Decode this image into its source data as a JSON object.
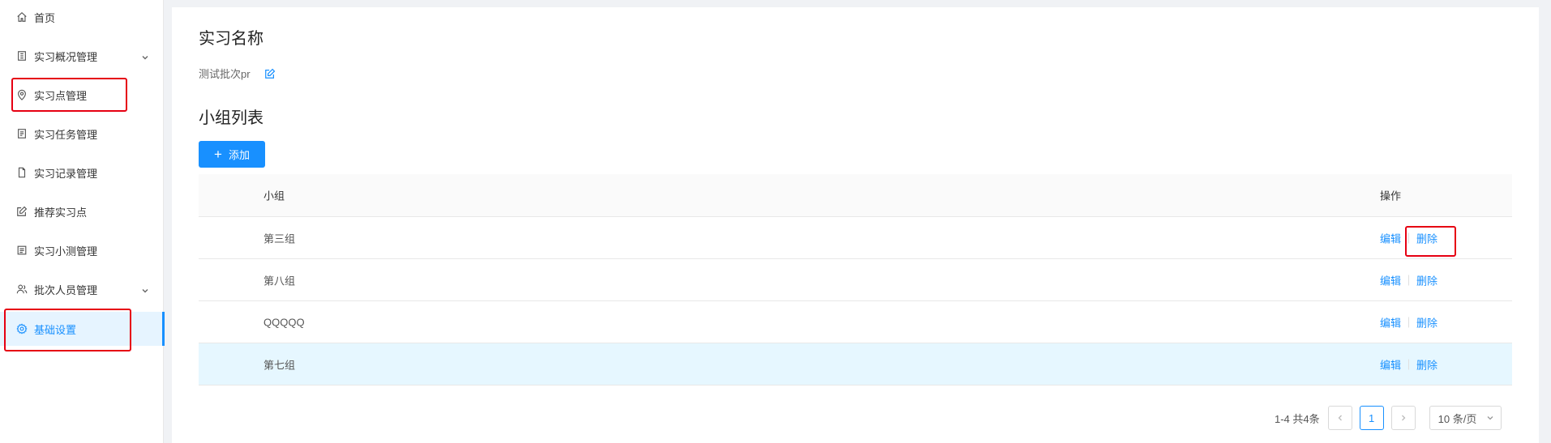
{
  "sidebar": {
    "items": [
      {
        "label": "首页",
        "icon": "home-icon"
      },
      {
        "label": "实习概况管理",
        "icon": "building-icon",
        "has_children": true
      },
      {
        "label": "实习点管理",
        "icon": "location-pin-icon"
      },
      {
        "label": "实习任务管理",
        "icon": "task-list-icon"
      },
      {
        "label": "实习记录管理",
        "icon": "document-icon"
      },
      {
        "label": "推荐实习点",
        "icon": "edit-icon"
      },
      {
        "label": "实习小测管理",
        "icon": "quiz-icon"
      },
      {
        "label": "批次人员管理",
        "icon": "users-icon",
        "has_children": true
      },
      {
        "label": "基础设置",
        "icon": "gear-icon",
        "active": true
      }
    ]
  },
  "main": {
    "internship_title": "实习名称",
    "batch_name": "测试批次pr",
    "group_list_title": "小组列表",
    "add_button": "添加",
    "table": {
      "headers": {
        "group": "小组",
        "actions": "操作"
      },
      "rows": [
        {
          "name": "第三组",
          "edit": "编辑",
          "delete": "删除"
        },
        {
          "name": "第八组",
          "edit": "编辑",
          "delete": "删除"
        },
        {
          "name": "QQQQQ",
          "edit": "编辑",
          "delete": "删除"
        },
        {
          "name": "第七组",
          "edit": "编辑",
          "delete": "删除",
          "highlighted": true
        }
      ]
    },
    "pagination": {
      "summary": "1-4 共4条",
      "current_page": "1",
      "page_size": "10 条/页"
    }
  },
  "colors": {
    "accent": "#1890ff",
    "annotation_red": "#e60012",
    "row_highlight": "#e6f7ff"
  }
}
